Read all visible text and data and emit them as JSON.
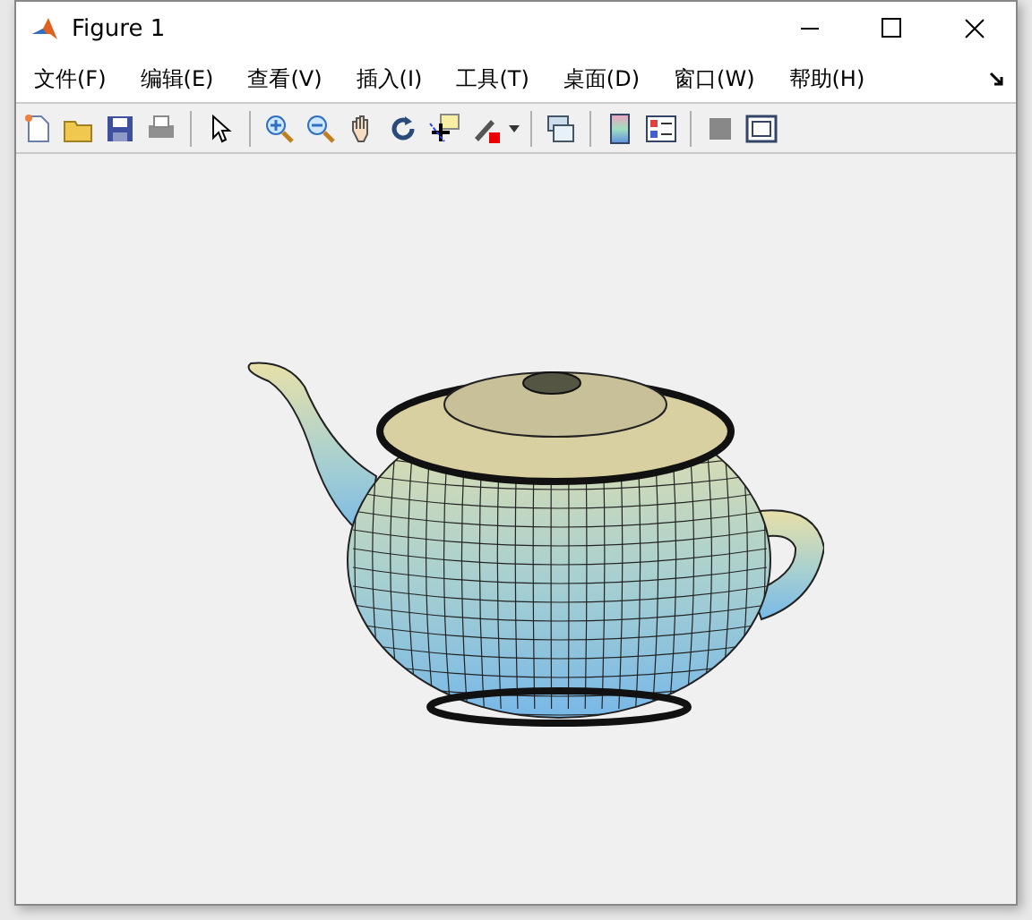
{
  "window": {
    "title": "Figure 1"
  },
  "menu": [
    "文件(F)",
    "编辑(E)",
    "查看(V)",
    "插入(I)",
    "工具(T)",
    "桌面(D)",
    "窗口(W)",
    "帮助(H)"
  ],
  "toolbar": [
    {
      "kind": "new"
    },
    {
      "kind": "open"
    },
    {
      "kind": "save"
    },
    {
      "kind": "print"
    },
    {
      "kind": "sep"
    },
    {
      "kind": "pointer"
    },
    {
      "kind": "sep"
    },
    {
      "kind": "zoomin"
    },
    {
      "kind": "zoomout"
    },
    {
      "kind": "pan"
    },
    {
      "kind": "rotate"
    },
    {
      "kind": "cursor"
    },
    {
      "kind": "brush"
    },
    {
      "kind": "sep"
    },
    {
      "kind": "link"
    },
    {
      "kind": "sep"
    },
    {
      "kind": "colorbar"
    },
    {
      "kind": "legend"
    },
    {
      "kind": "sep"
    },
    {
      "kind": "hide"
    },
    {
      "kind": "dock"
    }
  ]
}
